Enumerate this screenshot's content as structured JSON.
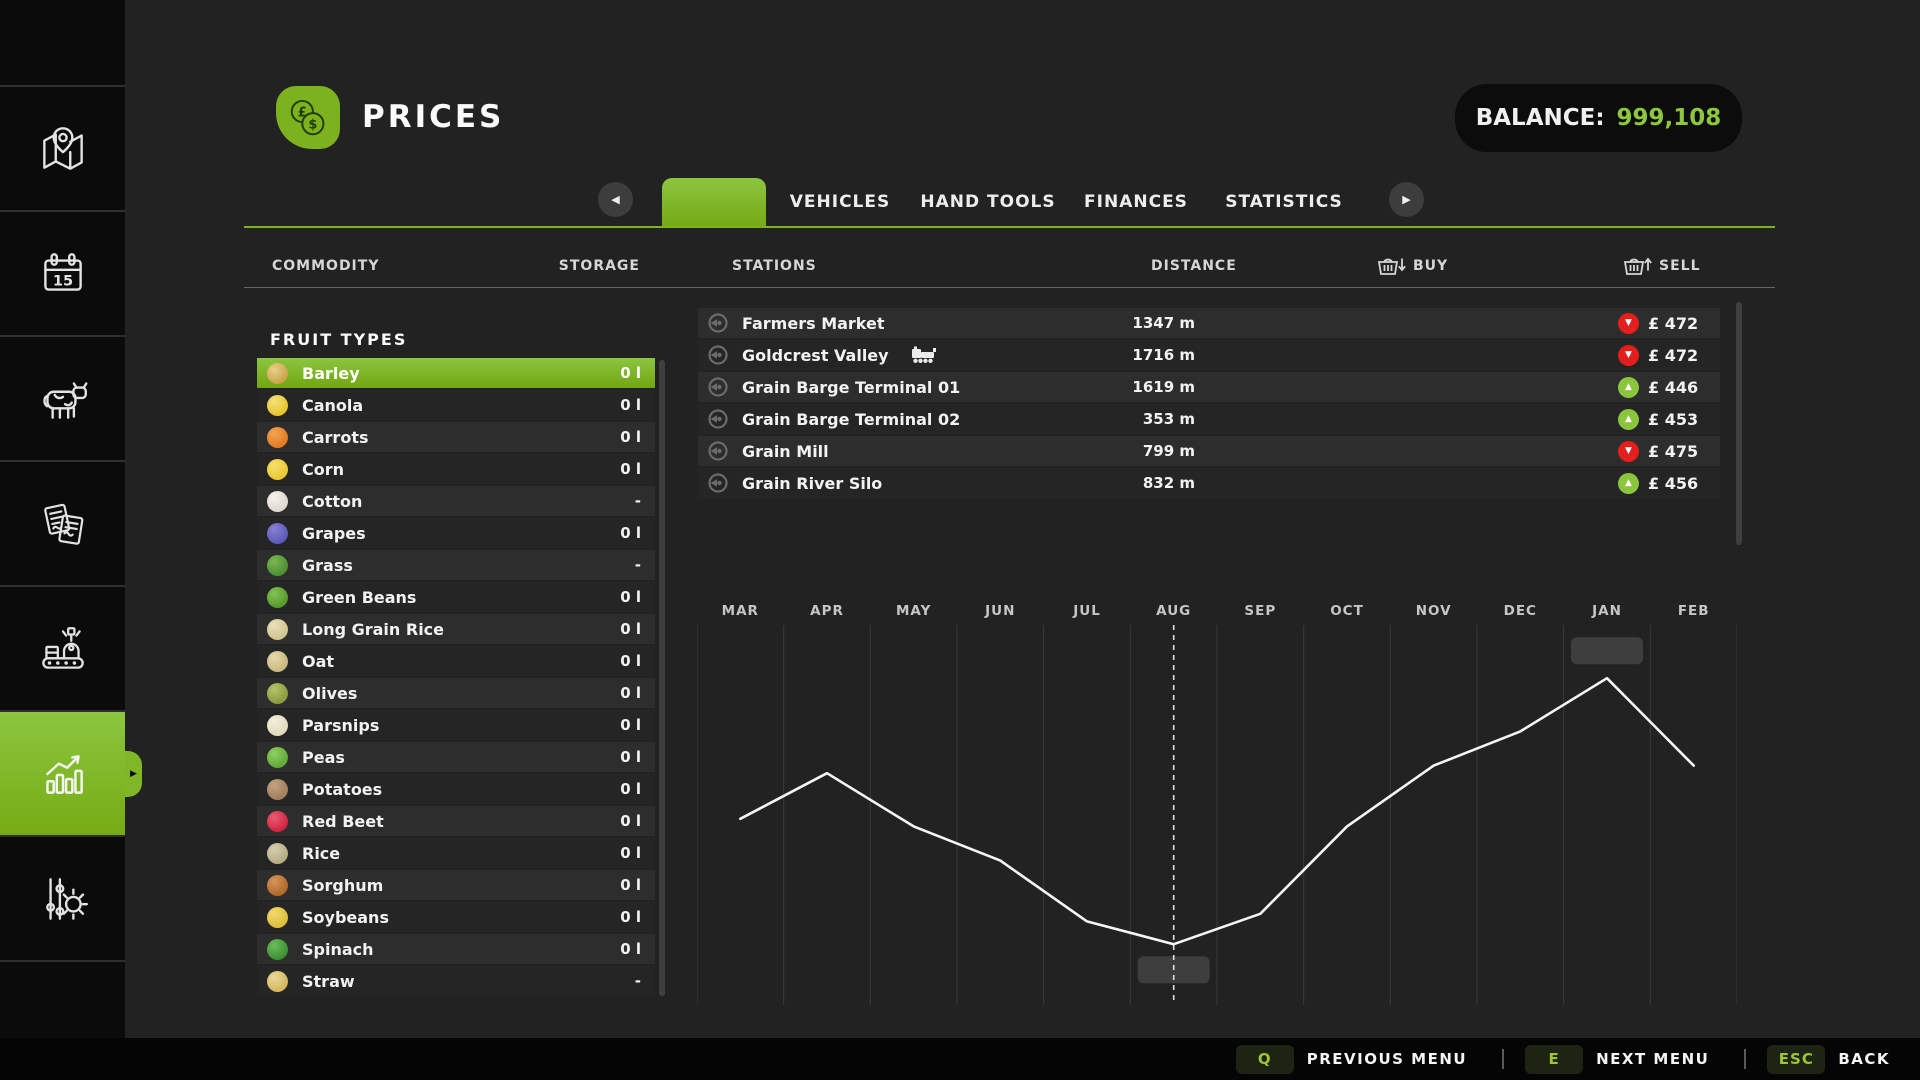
{
  "header": {
    "title": "PRICES",
    "balance_label": "BALANCE:",
    "balance_value": "999,108"
  },
  "colors": {
    "accent_green": "#7cb21e",
    "balance_green": "#8dc63f",
    "trend_up": "#8bc53c",
    "trend_down": "#e31e1e"
  },
  "sidebar": {
    "icons": [
      "map-icon",
      "calendar-icon",
      "animals-icon",
      "contracts-icon",
      "production-icon",
      "statistics-icon",
      "settings-icon"
    ],
    "active": "statistics-icon",
    "calendar_day": "15"
  },
  "tabs": {
    "active_label": "",
    "items": [
      "VEHICLES",
      "HAND TOOLS",
      "FINANCES",
      "STATISTICS"
    ],
    "prev_arrow": "◀",
    "next_arrow": "▶"
  },
  "columns": {
    "commodity": "COMMODITY",
    "storage": "STORAGE",
    "stations": "STATIONS",
    "distance": "DISTANCE",
    "buy": "BUY",
    "sell": "SELL"
  },
  "fruit_panel": {
    "title": "FRUIT TYPES",
    "items": [
      {
        "name": "Barley",
        "storage": "0 l",
        "selected": true,
        "icon": "barley-icon",
        "icon_colors": [
          "#caa64b",
          "#e8d08a"
        ]
      },
      {
        "name": "Canola",
        "storage": "0 l",
        "selected": false,
        "icon": "canola-icon",
        "icon_colors": [
          "#e6c52c",
          "#f4e27a"
        ]
      },
      {
        "name": "Carrots",
        "storage": "0 l",
        "selected": false,
        "icon": "carrots-icon",
        "icon_colors": [
          "#e07b28",
          "#f3a54e"
        ]
      },
      {
        "name": "Corn",
        "storage": "0 l",
        "selected": false,
        "icon": "corn-icon",
        "icon_colors": [
          "#e9c733",
          "#f7e06a"
        ]
      },
      {
        "name": "Cotton",
        "storage": "-",
        "selected": false,
        "icon": "cotton-icon",
        "icon_colors": [
          "#ddd8cf",
          "#f5f2ea"
        ]
      },
      {
        "name": "Grapes",
        "storage": "0 l",
        "selected": false,
        "icon": "grapes-icon",
        "icon_colors": [
          "#5b5bb5",
          "#8a7fd4"
        ]
      },
      {
        "name": "Grass",
        "storage": "-",
        "selected": false,
        "icon": "grass-icon",
        "icon_colors": [
          "#4e8f35",
          "#7ab84f"
        ]
      },
      {
        "name": "Green Beans",
        "storage": "0 l",
        "selected": false,
        "icon": "green-beans-icon",
        "icon_colors": [
          "#58982f",
          "#83c353"
        ]
      },
      {
        "name": "Long Grain Rice",
        "storage": "0 l",
        "selected": false,
        "icon": "long-grain-rice-icon",
        "icon_colors": [
          "#cfc38f",
          "#e9e0b8"
        ]
      },
      {
        "name": "Oat",
        "storage": "0 l",
        "selected": false,
        "icon": "oat-icon",
        "icon_colors": [
          "#c9b880",
          "#e5d9ab"
        ]
      },
      {
        "name": "Olives",
        "storage": "0 l",
        "selected": false,
        "icon": "olives-icon",
        "icon_colors": [
          "#8b9a3f",
          "#b5c468"
        ]
      },
      {
        "name": "Parsnips",
        "storage": "0 l",
        "selected": false,
        "icon": "parsnips-icon",
        "icon_colors": [
          "#e2d9bd",
          "#f4eeda"
        ]
      },
      {
        "name": "Peas",
        "storage": "0 l",
        "selected": false,
        "icon": "peas-icon",
        "icon_colors": [
          "#61a839",
          "#8fd062"
        ]
      },
      {
        "name": "Potatoes",
        "storage": "0 l",
        "selected": false,
        "icon": "potatoes-icon",
        "icon_colors": [
          "#9e7f5f",
          "#c4a37d"
        ]
      },
      {
        "name": "Red Beet",
        "storage": "0 l",
        "selected": false,
        "icon": "red-beet-icon",
        "icon_colors": [
          "#cf2540",
          "#ec5b72"
        ]
      },
      {
        "name": "Rice",
        "storage": "0 l",
        "selected": false,
        "icon": "rice-icon",
        "icon_colors": [
          "#b4ab85",
          "#d6cfae"
        ]
      },
      {
        "name": "Sorghum",
        "storage": "0 l",
        "selected": false,
        "icon": "sorghum-icon",
        "icon_colors": [
          "#b06a2c",
          "#d6945a"
        ]
      },
      {
        "name": "Soybeans",
        "storage": "0 l",
        "selected": false,
        "icon": "soybeans-icon",
        "icon_colors": [
          "#ddbe3a",
          "#f0d96e"
        ]
      },
      {
        "name": "Spinach",
        "storage": "0 l",
        "selected": false,
        "icon": "spinach-icon",
        "icon_colors": [
          "#3d9033",
          "#6cbb5d"
        ]
      },
      {
        "name": "Straw",
        "storage": "-",
        "selected": false,
        "icon": "straw-icon",
        "icon_colors": [
          "#d3b760",
          "#ecd79a"
        ]
      }
    ]
  },
  "stations": [
    {
      "name": "Farmers Market",
      "has_train_icon": false,
      "distance": "1347 m",
      "trend": "down",
      "price": "£ 472"
    },
    {
      "name": "Goldcrest Valley",
      "has_train_icon": true,
      "distance": "1716 m",
      "trend": "down",
      "price": "£ 472"
    },
    {
      "name": "Grain Barge Terminal 01",
      "has_train_icon": false,
      "distance": "1619 m",
      "trend": "up",
      "price": "£ 446"
    },
    {
      "name": "Grain Barge Terminal 02",
      "has_train_icon": false,
      "distance": "353 m",
      "trend": "up",
      "price": "£ 453"
    },
    {
      "name": "Grain Mill",
      "has_train_icon": false,
      "distance": "799 m",
      "trend": "down",
      "price": "£ 475"
    },
    {
      "name": "Grain River Silo",
      "has_train_icon": false,
      "distance": "832 m",
      "trend": "up",
      "price": "£ 456"
    }
  ],
  "chart_data": {
    "type": "line",
    "categories": [
      "MAR",
      "APR",
      "MAY",
      "JUN",
      "JUL",
      "AUG",
      "SEP",
      "OCT",
      "NOV",
      "DEC",
      "JAN",
      "FEB"
    ],
    "values": [
      49,
      61,
      47,
      38,
      22,
      16,
      24,
      47,
      63,
      72,
      86,
      63
    ],
    "value_note": "relative price index 0-100 estimated from line height; no y-axis labels are shown in the UI",
    "selected_category": "AUG",
    "annotations": [
      {
        "category": "JAN",
        "type": "empty-badge-above"
      },
      {
        "category": "AUG",
        "type": "empty-badge-below"
      }
    ],
    "xlabel": "",
    "ylabel": "",
    "ylim": [
      0,
      100
    ],
    "grid": true,
    "line_color": "#f5f5f5",
    "gridline_color": "#3b3b3b"
  },
  "footer": {
    "items": [
      {
        "key": "Q",
        "label": "PREVIOUS MENU"
      },
      {
        "key": "E",
        "label": "NEXT MENU"
      },
      {
        "key": "ESC",
        "label": "BACK"
      }
    ]
  }
}
